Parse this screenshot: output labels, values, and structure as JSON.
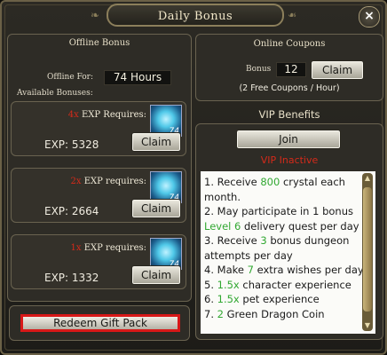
{
  "window": {
    "title": "Daily Bonus",
    "close_label": "×"
  },
  "offline": {
    "title": "Offline Bonus",
    "offline_for_label": "Offline For:",
    "offline_for_value": "74 Hours",
    "available_label": "Available Bonuses:",
    "bonuses": [
      {
        "multiplier": "4x",
        "requires": "EXP Requires:",
        "gem_count": "74",
        "exp": "EXP: 5328",
        "claim": "Claim"
      },
      {
        "multiplier": "2x",
        "requires": "EXP requires:",
        "gem_count": "74",
        "exp": "EXP: 2664",
        "claim": "Claim"
      },
      {
        "multiplier": "1x",
        "requires": "EXP requires:",
        "gem_count": "74",
        "exp": "EXP: 1332",
        "claim": "Claim"
      }
    ],
    "redeem_label": "Redeem Gift Pack"
  },
  "coupons": {
    "title": "Online Coupons",
    "bonus_label": "Bonus",
    "bonus_value": "12",
    "claim": "Claim",
    "note": "(2 Free Coupons / Hour)"
  },
  "vip": {
    "title": "VIP Benefits",
    "join_label": "Join",
    "status": "VIP Inactive",
    "status_color": "#d42a1a",
    "highlight_color": "#32a832",
    "benefits": [
      {
        "n": "1.",
        "pre": "Receive",
        "hl": "800",
        "post": "crystal each month."
      },
      {
        "n": "2.",
        "pre": "May participate in 1 bonus",
        "hl": "Level 6",
        "post": "delivery quest per day"
      },
      {
        "n": "3.",
        "pre": "Receive",
        "hl": "3",
        "post": "bonus dungeon attempts per day"
      },
      {
        "n": "4.",
        "pre": "Make",
        "hl": "7",
        "post": "extra wishes per day"
      },
      {
        "n": "5.",
        "pre": "",
        "hl": "1.5x",
        "post": "character experience"
      },
      {
        "n": "6.",
        "pre": "",
        "hl": "1.5x",
        "post": "pet experience"
      },
      {
        "n": "7.",
        "pre": "",
        "hl": "2",
        "post": "Green Dragon Coin"
      }
    ]
  }
}
